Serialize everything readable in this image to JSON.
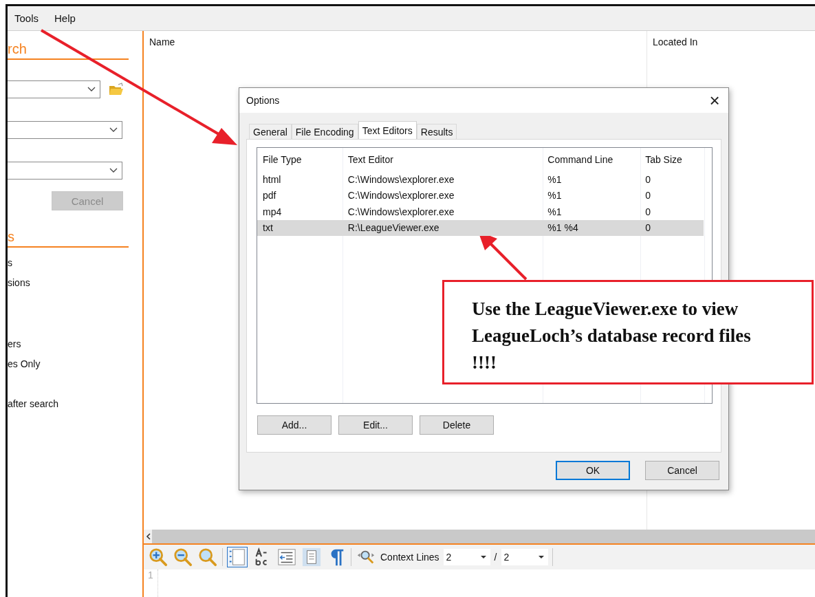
{
  "menu": [
    "Tools",
    "Help"
  ],
  "left_panel": {
    "heading_top": "rch",
    "cancel_button": {
      "label": "Cancel",
      "disabled": true
    },
    "heading_bottom": "s",
    "options": [
      "s",
      "sions",
      "ers",
      "es Only",
      "after search"
    ]
  },
  "results": {
    "columns": [
      "Name",
      "Located In"
    ]
  },
  "dialog": {
    "title": "Options",
    "close": "×",
    "tabs": [
      {
        "label": "General",
        "selected": false
      },
      {
        "label": "File Encoding",
        "selected": false
      },
      {
        "label": "Text Editors",
        "selected": true
      },
      {
        "label": "Results",
        "selected": false
      }
    ],
    "columns": [
      "File Type",
      "Text Editor",
      "Command Line",
      "Tab Size"
    ],
    "rows": [
      {
        "cells": [
          "html",
          "C:\\Windows\\explorer.exe",
          "%1",
          "0"
        ],
        "selected": false
      },
      {
        "cells": [
          "pdf",
          "C:\\Windows\\explorer.exe",
          "%1",
          "0"
        ],
        "selected": false
      },
      {
        "cells": [
          "mp4",
          "C:\\Windows\\explorer.exe",
          "%1",
          "0"
        ],
        "selected": false
      },
      {
        "cells": [
          "txt",
          "R:\\LeagueViewer.exe",
          "%1 %4",
          "0"
        ],
        "selected": true
      }
    ],
    "list_buttons": [
      "Add...",
      "Edit...",
      "Delete"
    ],
    "footer_buttons": [
      {
        "label": "OK",
        "focused": true
      },
      {
        "label": "Cancel",
        "focused": false
      }
    ]
  },
  "toolbar": {
    "tools": [
      {
        "kind": "zoom-in",
        "selected": false
      },
      {
        "kind": "zoom-out",
        "selected": false
      },
      {
        "kind": "zoom",
        "selected": false
      },
      {
        "kind": "line-numbers",
        "selected": true
      },
      {
        "kind": "hyphen",
        "selected": false
      },
      {
        "kind": "indent",
        "selected": false
      },
      {
        "kind": "fit",
        "selected": false
      },
      {
        "kind": "pilcrow",
        "selected": false
      },
      {
        "kind": "find",
        "selected": false
      }
    ],
    "context_label": "Context Lines",
    "before": "2",
    "separator": "/",
    "after": "2"
  },
  "editor": {
    "line_numbers": [
      "1"
    ]
  },
  "annotation": "Use the LeagueViewer.exe to view LeagueLoch’s database record files  !!!!"
}
